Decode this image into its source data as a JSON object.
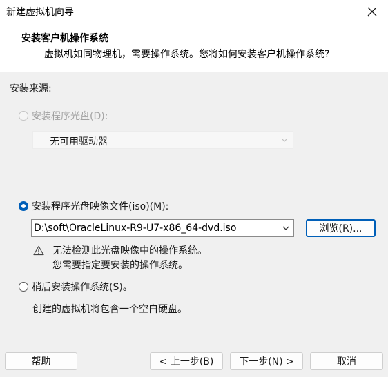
{
  "window": {
    "title": "新建虚拟机向导",
    "close_icon": "close-icon"
  },
  "header": {
    "title": "安装客户机操作系统",
    "subtitle": "虚拟机如同物理机，需要操作系统。您将如何安装客户机操作系统?"
  },
  "install_source": {
    "label": "安装来源:",
    "disc_option": {
      "label": "安装程序光盘(D):",
      "selected": false,
      "enabled": false,
      "drive_value": "无可用驱动器"
    },
    "iso_option": {
      "label": "安装程序光盘映像文件(iso)(M):",
      "selected": true,
      "path_value": "D:\\soft\\OracleLinux-R9-U7-x86_64-dvd.iso",
      "browse_label": "浏览(R)...",
      "warning_icon": "warning-triangle-icon",
      "warning_line1": "无法检测此光盘映像中的操作系统。",
      "warning_line2": "您需要指定要安装的操作系统。"
    },
    "later_option": {
      "label": "稍后安装操作系统(S)。",
      "selected": false,
      "note": "创建的虚拟机将包含一个空白硬盘。"
    }
  },
  "footer": {
    "help_label": "帮助",
    "back_label": "< 上一步(B)",
    "next_label": "下一步(N) >",
    "cancel_label": "取消"
  },
  "colors": {
    "accent": "#005fb8",
    "window_bg": "#f0f0f0",
    "header_bg": "#ffffff",
    "disabled_text": "#a2a2a2"
  }
}
